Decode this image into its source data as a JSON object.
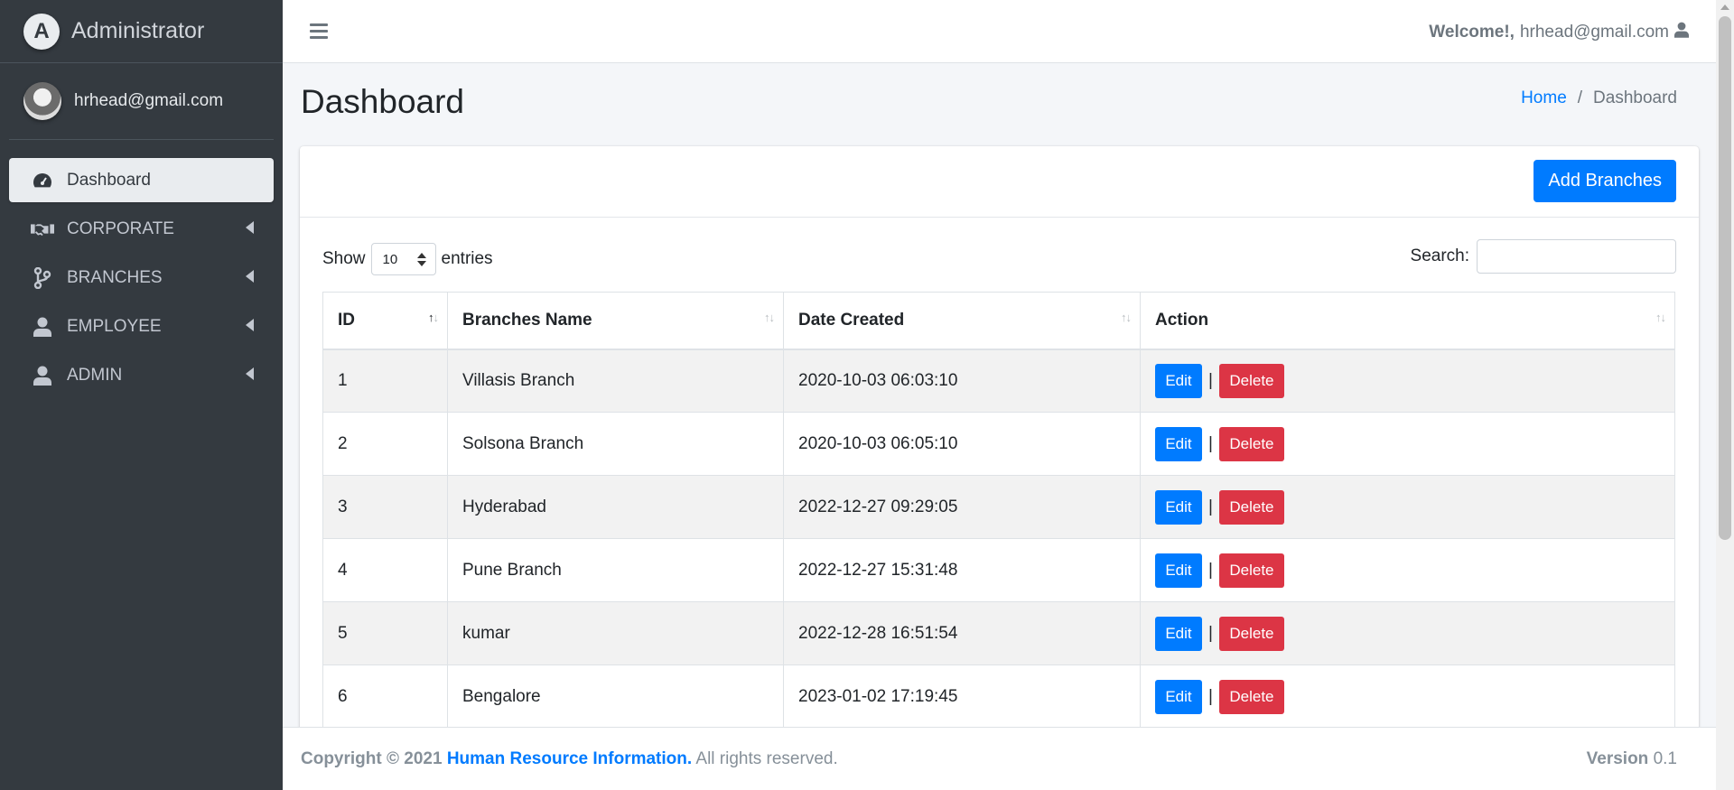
{
  "brand": {
    "logo_letter": "A",
    "title": "Administrator"
  },
  "user": {
    "email": "hrhead@gmail.com"
  },
  "sidebar": {
    "items": [
      {
        "label": "Dashboard",
        "icon": "tachometer-icon",
        "active": true
      },
      {
        "label": "CORPORATE",
        "icon": "handshake-icon"
      },
      {
        "label": "BRANCHES",
        "icon": "code-branch-icon"
      },
      {
        "label": "EMPLOYEE",
        "icon": "user-icon"
      },
      {
        "label": "ADMIN",
        "icon": "user-icon"
      }
    ]
  },
  "topbar": {
    "welcome_label": "Welcome!,",
    "welcome_email": "hrhead@gmail.com"
  },
  "header": {
    "title": "Dashboard",
    "breadcrumb": {
      "home": "Home",
      "sep": "/",
      "current": "Dashboard"
    }
  },
  "card": {
    "add_button": "Add Branches"
  },
  "controls": {
    "show_label": "Show",
    "entries_value": "10",
    "entries_label": "entries",
    "search_label": "Search:"
  },
  "table": {
    "columns": [
      "ID",
      "Branches Name",
      "Date Created",
      "Action"
    ],
    "rows": [
      {
        "id": "1",
        "name": "Villasis Branch",
        "date": "2020-10-03 06:03:10"
      },
      {
        "id": "2",
        "name": "Solsona Branch",
        "date": "2020-10-03 06:05:10"
      },
      {
        "id": "3",
        "name": "Hyderabad",
        "date": "2022-12-27 09:29:05"
      },
      {
        "id": "4",
        "name": "Pune Branch",
        "date": "2022-12-27 15:31:48"
      },
      {
        "id": "5",
        "name": "kumar",
        "date": "2022-12-28 16:51:54"
      },
      {
        "id": "6",
        "name": "Bengalore",
        "date": "2023-01-02 17:19:45"
      }
    ],
    "edit_label": "Edit",
    "delete_label": "Delete",
    "separator": "|",
    "sort_glyph": "↑↓"
  },
  "footer": {
    "copyright": "Copyright © 2021",
    "org": "Human Resource Information.",
    "rights": "All rights reserved.",
    "version_label": "Version",
    "version_value": "0.1"
  },
  "colors": {
    "primary": "#007bff",
    "danger": "#dc3545",
    "sidebar_bg": "#343a40"
  }
}
